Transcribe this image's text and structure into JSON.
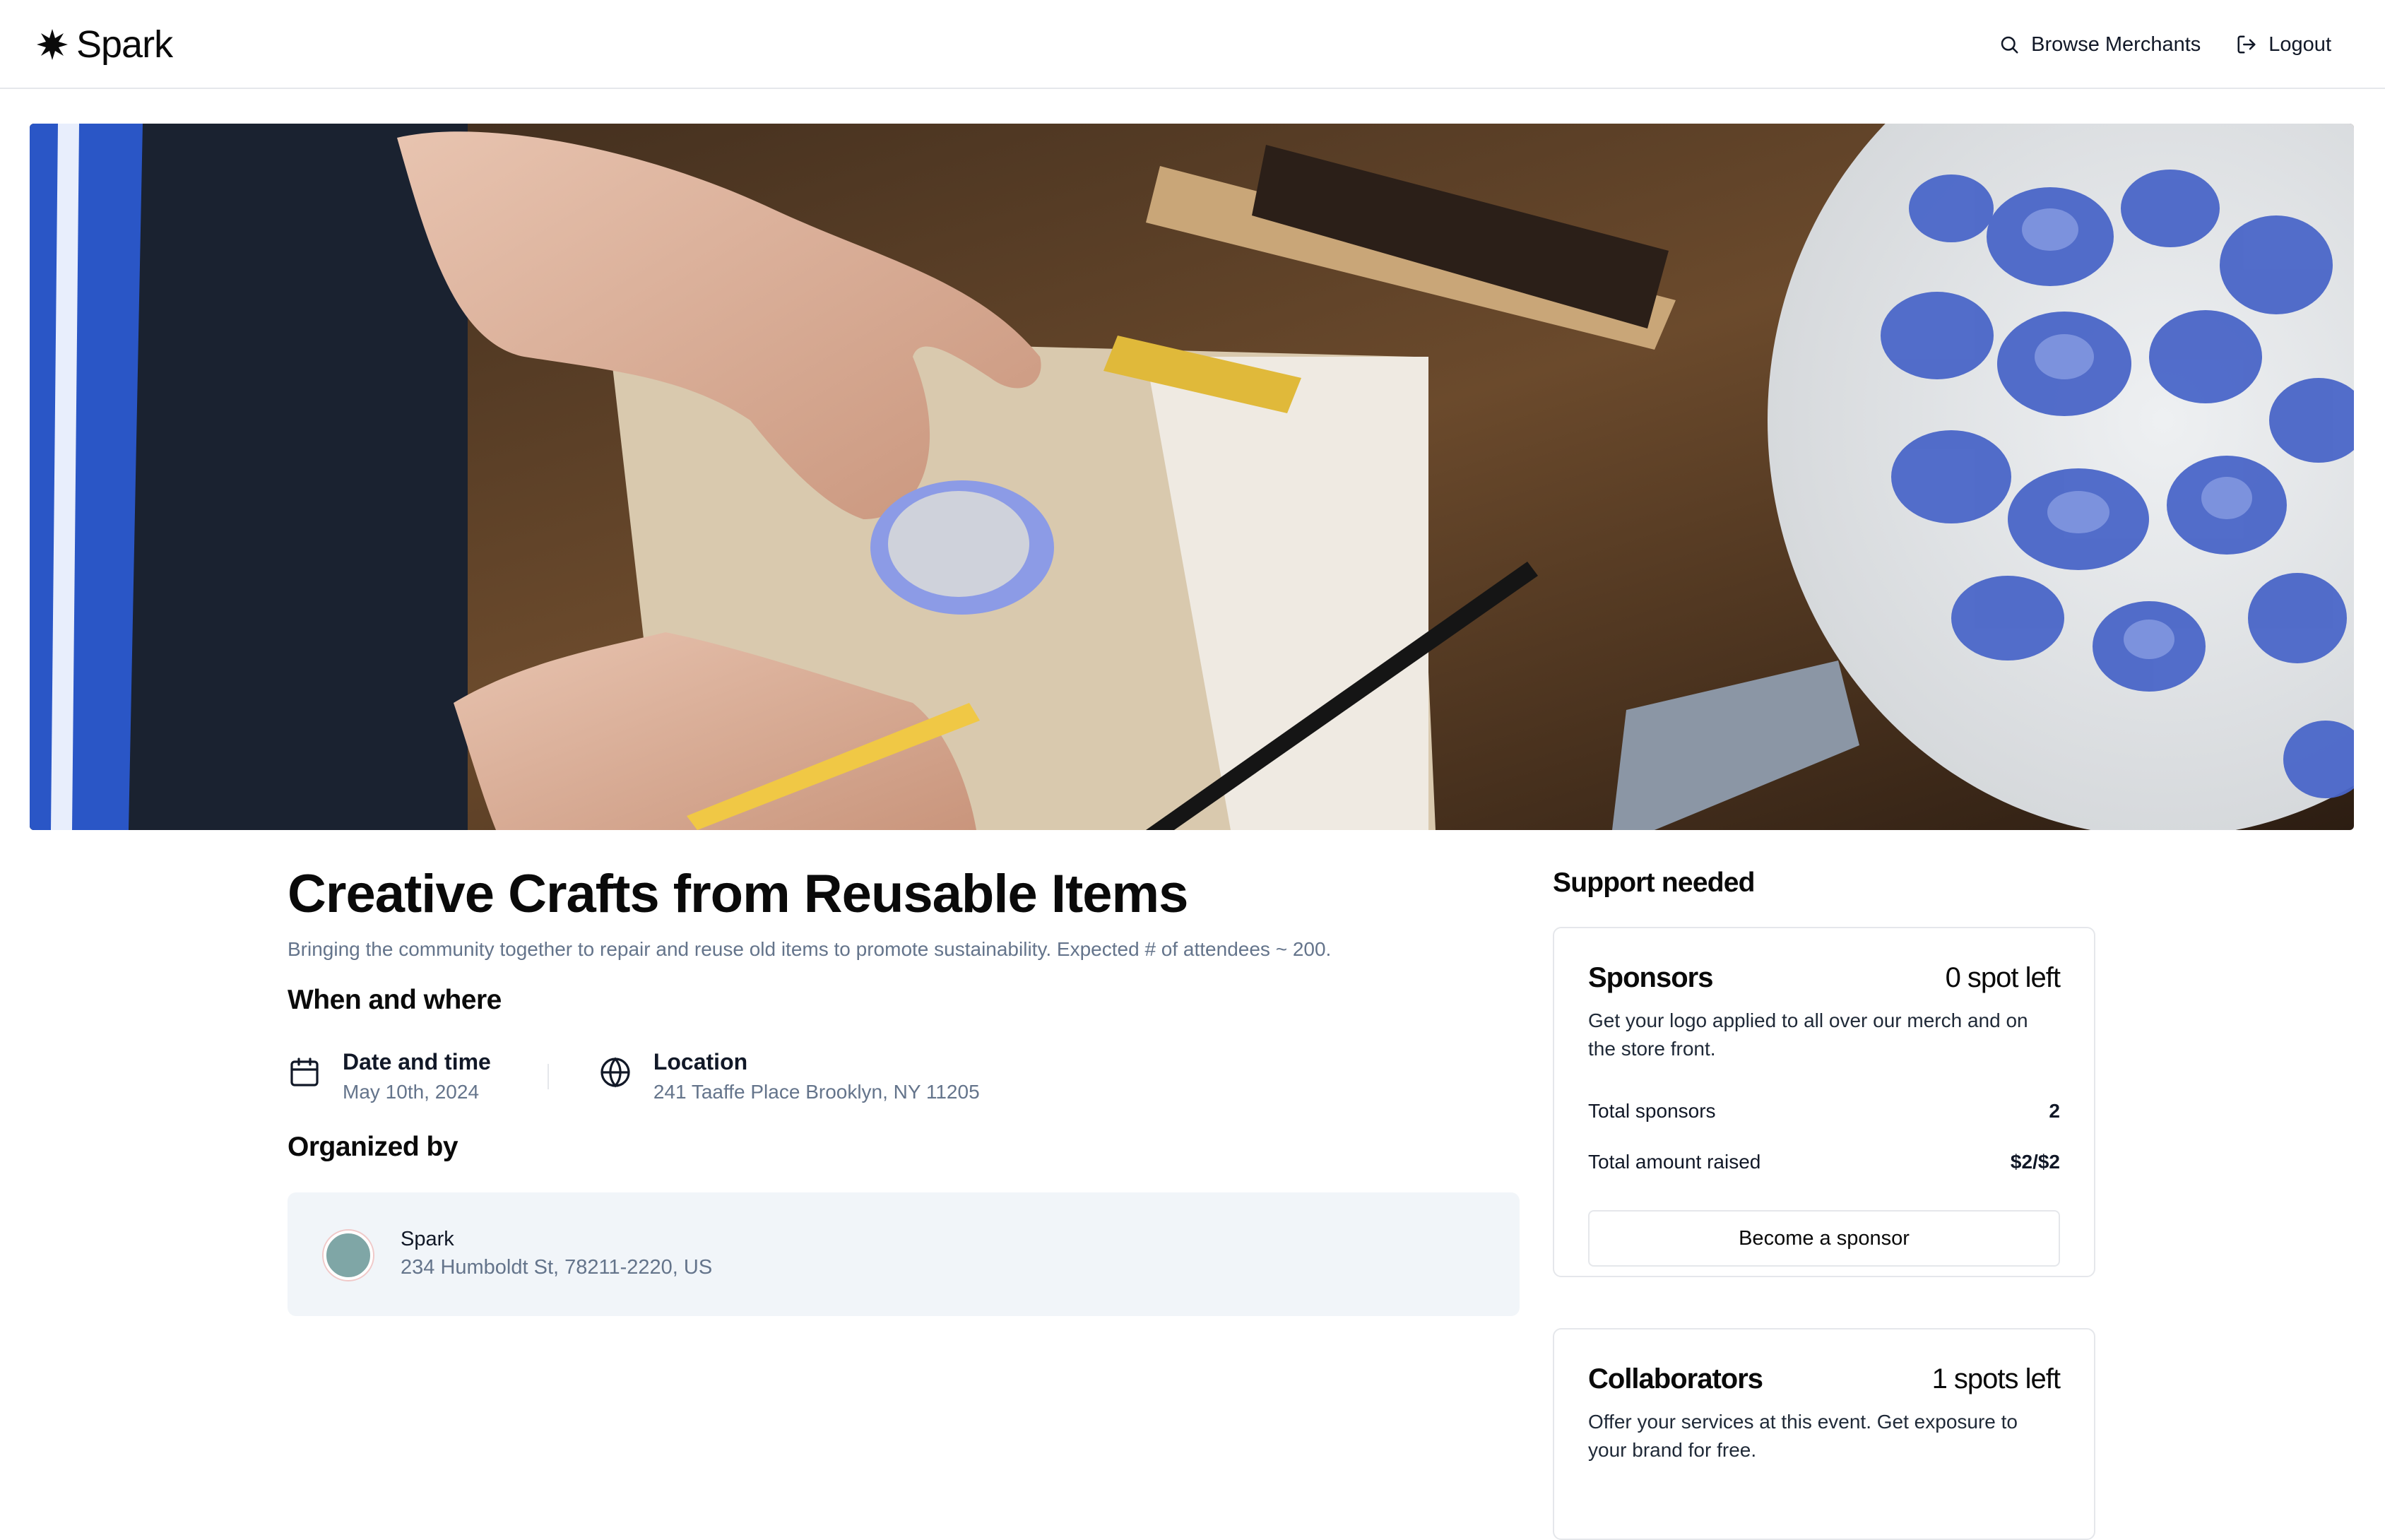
{
  "header": {
    "brand": "Spark",
    "nav": [
      {
        "label": "Browse Merchants",
        "icon": "search-icon"
      },
      {
        "label": "Logout",
        "icon": "logout-icon"
      }
    ]
  },
  "event": {
    "title": "Creative Crafts from Reusable Items",
    "description": "Bringing the community together to repair and reuse old items to promote sustainability. Expected # of attendees ~ 200.",
    "when_where_heading": "When and where",
    "date_label": "Date and time",
    "date_value": "May 10th, 2024",
    "location_label": "Location",
    "location_value": "241 Taaffe Place Brooklyn, NY 11205",
    "organized_heading": "Organized by",
    "organizer": {
      "name": "Spark",
      "address": "234 Humboldt St, 78211-2220, US"
    }
  },
  "support": {
    "heading": "Support needed",
    "sponsors": {
      "title": "Sponsors",
      "spots": "0 spot left",
      "description": "Get your logo applied to all over our merch and on the store front.",
      "total_sponsors_label": "Total sponsors",
      "total_sponsors_value": "2",
      "total_raised_label": "Total amount raised",
      "total_raised_value": "$2/$2",
      "button_label": "Become a sponsor"
    },
    "collaborators": {
      "title": "Collaborators",
      "spots": "1 spots left",
      "description": "Offer your services at this event. Get exposure to your brand for free."
    }
  },
  "colors": {
    "accent_text": "#0a0a0a",
    "muted_text": "#64748b",
    "card_border": "#e5e7eb",
    "org_card_bg": "#f1f5f9",
    "hero_clay_blue": "#4a66c8"
  }
}
